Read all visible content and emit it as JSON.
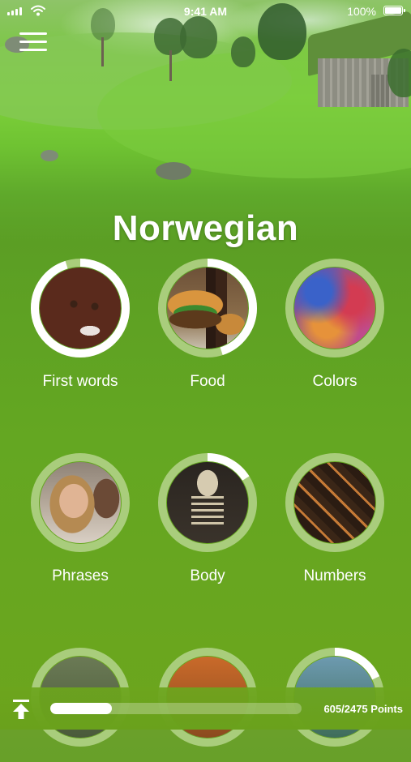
{
  "status_bar": {
    "time": "9:41 AM",
    "battery": "100%"
  },
  "header": {
    "title": "Norwegian"
  },
  "colors": {
    "ring_track": "#a9cd7c",
    "ring_progress": "#ffffff",
    "accent": "#6aa11c"
  },
  "topics": [
    {
      "label": "First words",
      "progress": 0.95,
      "image": "baby-photo"
    },
    {
      "label": "Food",
      "progress": 0.45,
      "image": "burger-photo"
    },
    {
      "label": "Colors",
      "progress": 0,
      "image": "paint-powder-photo"
    },
    {
      "label": "Phrases",
      "progress": 0,
      "image": "smiling-woman-photo"
    },
    {
      "label": "Body",
      "progress": 0.16,
      "image": "skeleton-photo"
    },
    {
      "label": "Numbers",
      "progress": 0,
      "image": "metal-type-photo"
    },
    {
      "label": "",
      "progress": 0,
      "image": "topic-photo"
    },
    {
      "label": "",
      "progress": 0,
      "image": "topic-photo"
    },
    {
      "label": "",
      "progress": 0.18,
      "image": "topic-photo"
    }
  ],
  "footer": {
    "points_label": "605/2475 Points",
    "points_progress": 0.244
  }
}
